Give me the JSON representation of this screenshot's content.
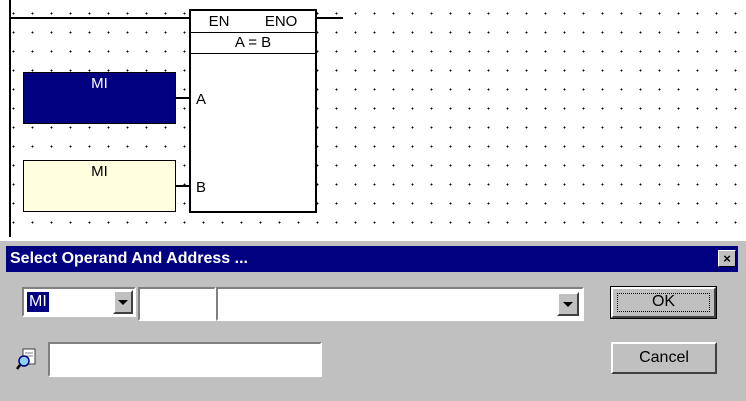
{
  "ladder": {
    "block": {
      "en_label": "EN",
      "eno_label": "ENO",
      "function_label": "A = B",
      "pin_a_label": "A",
      "pin_b_label": "B"
    },
    "operand_a": {
      "label": "MI",
      "state": "selected"
    },
    "operand_b": {
      "label": "MI",
      "state": "normal"
    }
  },
  "dialog": {
    "title": "Select Operand And Address ...",
    "operand_type": {
      "selected": "MI"
    },
    "address_value": "",
    "description_value": "",
    "search_value": "",
    "ok_label": "OK",
    "cancel_label": "Cancel",
    "close_glyph": "×",
    "icons": {
      "search": "search-icon",
      "close": "close-icon",
      "dropdown": "chevron-down-icon"
    }
  },
  "colors": {
    "selection": "#000080",
    "operand_fill": "#ffffe0",
    "dialog_face": "#c0c0c0"
  }
}
